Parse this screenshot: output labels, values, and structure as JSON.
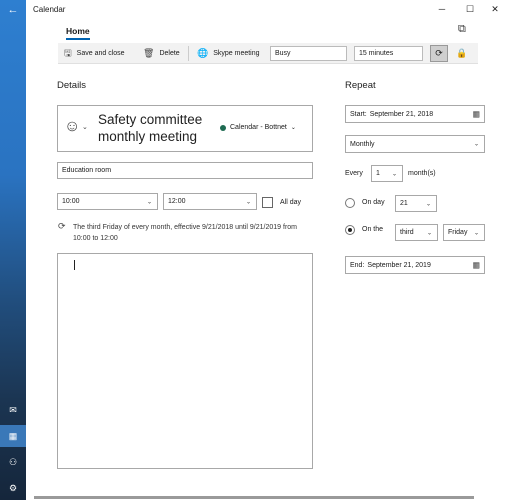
{
  "window": {
    "title": "Calendar",
    "minimize_icon": "minimize-icon",
    "maximize_icon": "maximize-icon",
    "close_icon": "close-icon"
  },
  "tabs": [
    {
      "label": "Home",
      "active": true
    }
  ],
  "toolbar": {
    "save_label": "Save and close",
    "delete_label": "Delete",
    "skype_label": "Skype meeting",
    "show_as_value": "Busy",
    "reminder_value": "15 minutes"
  },
  "details": {
    "heading": "Details",
    "subject": "Safety committee monthly meeting",
    "calendar_name": "Calendar - Bottnet",
    "calendar_color": "#1e6b52",
    "location": "Education room",
    "start_time": "10:00",
    "end_time": "12:00",
    "all_day_label": "All day",
    "all_day_checked": false,
    "recurrence_summary": "The third Friday of every month, effective 9/21/2018 until 9/21/2019 from 10:00 to 12:00"
  },
  "repeat": {
    "heading": "Repeat",
    "start_label": "Start:",
    "start_value": "September 21, 2018",
    "frequency": "Monthly",
    "every_label": "Every",
    "every_value": "1",
    "every_unit": "month(s)",
    "on_day_label": "On day",
    "on_day_value": "21",
    "on_day_selected": false,
    "on_the_label": "On the",
    "on_the_ordinal": "third",
    "on_the_weekday": "Friday",
    "on_the_selected": true,
    "end_label": "End:",
    "end_value": "September 21, 2019"
  },
  "colors": {
    "accent": "#0063b1",
    "rail_top": "#2e7fd0",
    "rail_bottom": "#15263b"
  }
}
